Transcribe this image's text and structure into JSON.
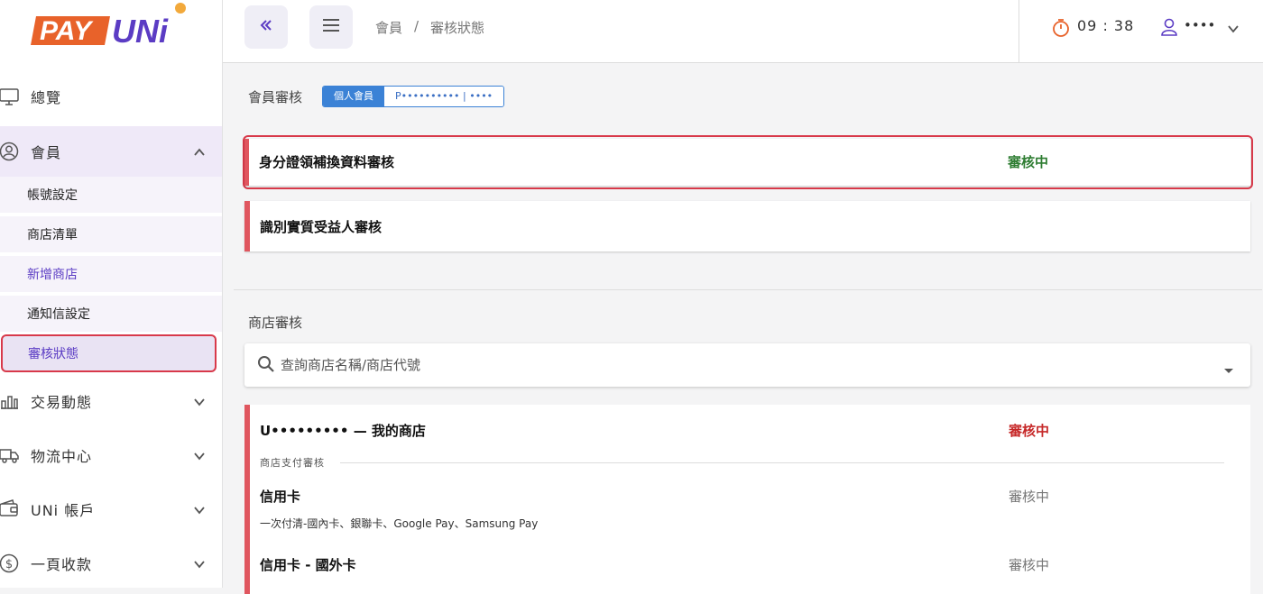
{
  "logo": {
    "text_left": "PAY",
    "text_right": "UNi"
  },
  "sidebar": {
    "items": [
      {
        "label": "總覽"
      },
      {
        "label": "會員"
      },
      {
        "label": "交易動態"
      },
      {
        "label": "物流中心"
      },
      {
        "label": "UNi 帳戶"
      },
      {
        "label": "一頁收款"
      }
    ],
    "subitems": [
      {
        "label": "帳號設定"
      },
      {
        "label": "商店清單"
      },
      {
        "label": "新增商店"
      },
      {
        "label": "通知信設定"
      },
      {
        "label": "審核狀態"
      }
    ]
  },
  "topbar": {
    "breadcrumb": [
      "會員",
      "/",
      "審核狀態"
    ],
    "timer": "09 : 38",
    "user": "••••"
  },
  "member_review": {
    "title": "會員審核",
    "tags": [
      "個人會員",
      "P•••••••••• | ••••"
    ],
    "cards": [
      {
        "title": "身分證領補換資料審核",
        "status": "審核中"
      },
      {
        "title": "識別實質受益人審核",
        "status": ""
      }
    ]
  },
  "store_review": {
    "title": "商店審核",
    "search_placeholder": "查詢商店名稱/商店代號",
    "store": {
      "title": "U••••••••• — 我的商店",
      "status": "審核中",
      "section_label": "商店支付審核",
      "methods": [
        {
          "title": "信用卡",
          "desc": "一次付清-國內卡、銀聯卡、Google Pay、Samsung Pay",
          "status": "審核中"
        },
        {
          "title": "信用卡 - 國外卡",
          "desc": "",
          "status": "審核中"
        }
      ]
    }
  },
  "colors": {
    "accent": "#5b3cc4",
    "brand_orange": "#e8622a",
    "status_green": "#2e7d32",
    "status_red": "#c62828",
    "highlight": "#d8394a"
  }
}
